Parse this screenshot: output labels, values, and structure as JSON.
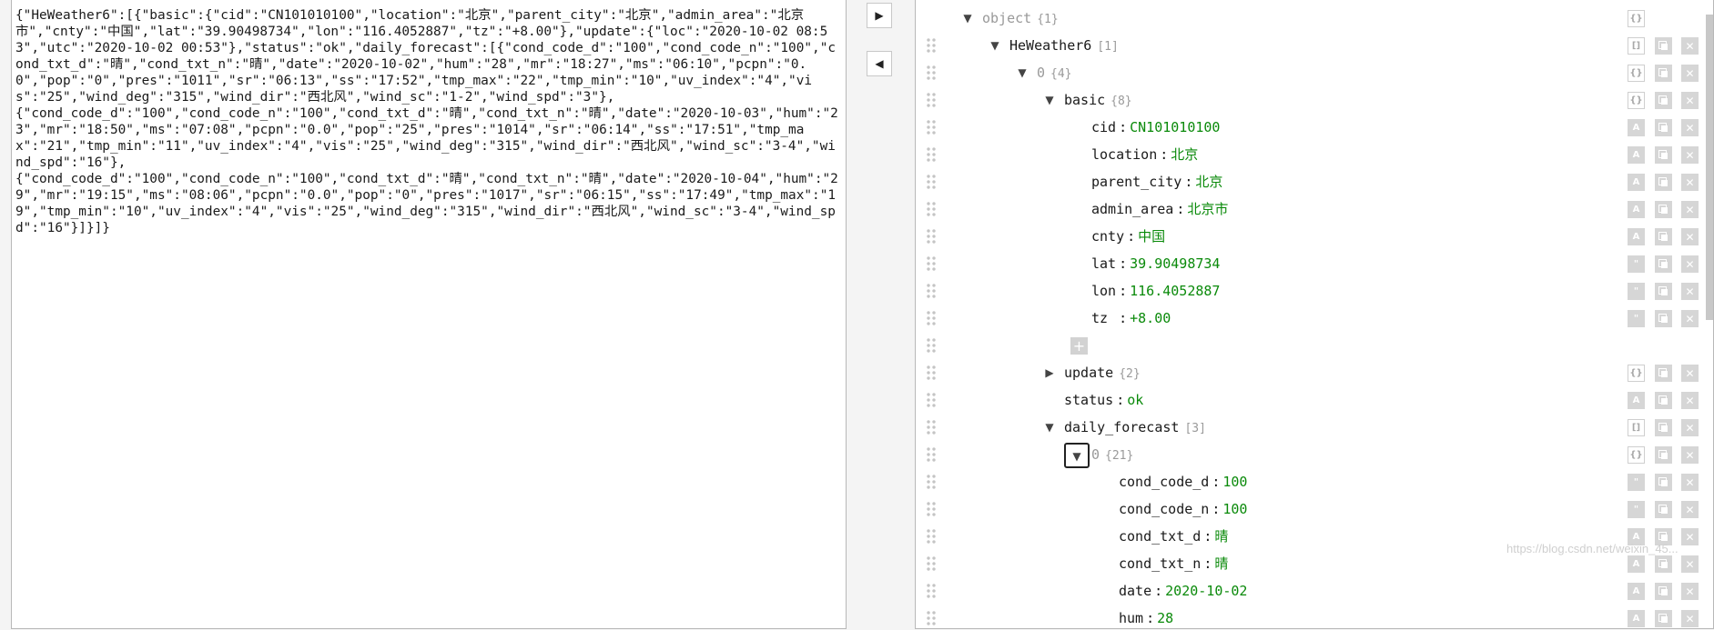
{
  "raw_json": "{\"HeWeather6\":[{\"basic\":{\"cid\":\"CN101010100\",\"location\":\"北京\",\"parent_city\":\"北京\",\"admin_area\":\"北京市\",\"cnty\":\"中国\",\"lat\":\"39.90498734\",\"lon\":\"116.4052887\",\"tz\":\"+8.00\"},\"update\":{\"loc\":\"2020-10-02 08:53\",\"utc\":\"2020-10-02 00:53\"},\"status\":\"ok\",\"daily_forecast\":[{\"cond_code_d\":\"100\",\"cond_code_n\":\"100\",\"cond_txt_d\":\"晴\",\"cond_txt_n\":\"晴\",\"date\":\"2020-10-02\",\"hum\":\"28\",\"mr\":\"18:27\",\"ms\":\"06:10\",\"pcpn\":\"0.0\",\"pop\":\"0\",\"pres\":\"1011\",\"sr\":\"06:13\",\"ss\":\"17:52\",\"tmp_max\":\"22\",\"tmp_min\":\"10\",\"uv_index\":\"4\",\"vis\":\"25\",\"wind_deg\":\"315\",\"wind_dir\":\"西北风\",\"wind_sc\":\"1-2\",\"wind_spd\":\"3\"},\n{\"cond_code_d\":\"100\",\"cond_code_n\":\"100\",\"cond_txt_d\":\"晴\",\"cond_txt_n\":\"晴\",\"date\":\"2020-10-03\",\"hum\":\"23\",\"mr\":\"18:50\",\"ms\":\"07:08\",\"pcpn\":\"0.0\",\"pop\":\"25\",\"pres\":\"1014\",\"sr\":\"06:14\",\"ss\":\"17:51\",\"tmp_max\":\"21\",\"tmp_min\":\"11\",\"uv_index\":\"4\",\"vis\":\"25\",\"wind_deg\":\"315\",\"wind_dir\":\"西北风\",\"wind_sc\":\"3-4\",\"wind_spd\":\"16\"},\n{\"cond_code_d\":\"100\",\"cond_code_n\":\"100\",\"cond_txt_d\":\"晴\",\"cond_txt_n\":\"晴\",\"date\":\"2020-10-04\",\"hum\":\"29\",\"mr\":\"19:15\",\"ms\":\"08:06\",\"pcpn\":\"0.0\",\"pop\":\"0\",\"pres\":\"1017\",\"sr\":\"06:15\",\"ss\":\"17:49\",\"tmp_max\":\"19\",\"tmp_min\":\"10\",\"uv_index\":\"4\",\"vis\":\"25\",\"wind_deg\":\"315\",\"wind_dir\":\"西北风\",\"wind_sc\":\"3-4\",\"wind_spd\":\"16\"}]}]}",
  "controls": {
    "copy_right_icon": "▶",
    "copy_left_icon": "◀"
  },
  "tree": {
    "colors": {
      "value": "#0a8a0a",
      "meta": "#9a9a9a"
    },
    "rows": [
      {
        "indent": 0,
        "toggle": "▼",
        "key": "object",
        "key_muted": true,
        "meta": "{1}",
        "type_icon": "{}",
        "actions": false
      },
      {
        "indent": 1,
        "toggle": "▼",
        "key": "HeWeather6",
        "meta": "[1]",
        "type_icon": "[]",
        "actions": true
      },
      {
        "indent": 2,
        "toggle": "▼",
        "key": "0",
        "key_muted": true,
        "meta": "{4}",
        "type_icon": "{}",
        "actions": true
      },
      {
        "indent": 3,
        "toggle": "▼",
        "key": "basic",
        "meta": "{8}",
        "type_icon": "{}",
        "actions": true
      },
      {
        "indent": 4,
        "key": "cid",
        "value": "CN101010100",
        "type_icon": "A",
        "actions": true
      },
      {
        "indent": 4,
        "key": "location",
        "value": "北京",
        "type_icon": "A",
        "actions": true
      },
      {
        "indent": 4,
        "key": "parent_city",
        "value": "北京",
        "type_icon": "A",
        "actions": true
      },
      {
        "indent": 4,
        "key": "admin_area",
        "value": "北京市",
        "type_icon": "A",
        "actions": true
      },
      {
        "indent": 4,
        "key": "cnty",
        "value": "中国",
        "type_icon": "A",
        "actions": true
      },
      {
        "indent": 4,
        "key": "lat",
        "value": "39.90498734",
        "type_icon": "\"",
        "actions": true
      },
      {
        "indent": 4,
        "key": "lon",
        "value": "116.4052887",
        "type_icon": "\"",
        "actions": true
      },
      {
        "indent": 4,
        "key": "tz  ",
        "value": "+8.00",
        "type_icon": "\"",
        "actions": true
      },
      {
        "indent": 4,
        "add": true,
        "add_icon": "+"
      },
      {
        "indent": 3,
        "toggle": "▶",
        "key": "update",
        "meta": "{2}",
        "type_icon": "{}",
        "actions": true
      },
      {
        "indent": 3,
        "key": "status",
        "value": "ok",
        "type_icon": "A",
        "actions": true
      },
      {
        "indent": 3,
        "toggle": "▼",
        "key": "daily_forecast",
        "meta": "[3]",
        "type_icon": "[]",
        "actions": true
      },
      {
        "indent": 4,
        "toggle": "▼",
        "toggle_boxed": true,
        "key": "0",
        "key_muted": true,
        "meta": "{21}",
        "type_icon": "{}",
        "actions": true
      },
      {
        "indent": 5,
        "key": "cond_code_d",
        "value": "100",
        "type_icon": "\"",
        "actions": true
      },
      {
        "indent": 5,
        "key": "cond_code_n",
        "value": "100",
        "type_icon": "\"",
        "actions": true
      },
      {
        "indent": 5,
        "key": "cond_txt_d",
        "value": "晴",
        "type_icon": "A",
        "actions": true
      },
      {
        "indent": 5,
        "key": "cond_txt_n",
        "value": "晴",
        "type_icon": "A",
        "actions": true
      },
      {
        "indent": 5,
        "key": "date",
        "value": "2020-10-02",
        "type_icon": "A",
        "actions": true
      },
      {
        "indent": 5,
        "key": "hum",
        "value": "28",
        "type_icon": "A",
        "actions": true
      }
    ]
  },
  "watermark": "https://blog.csdn.net/weixin_45..."
}
